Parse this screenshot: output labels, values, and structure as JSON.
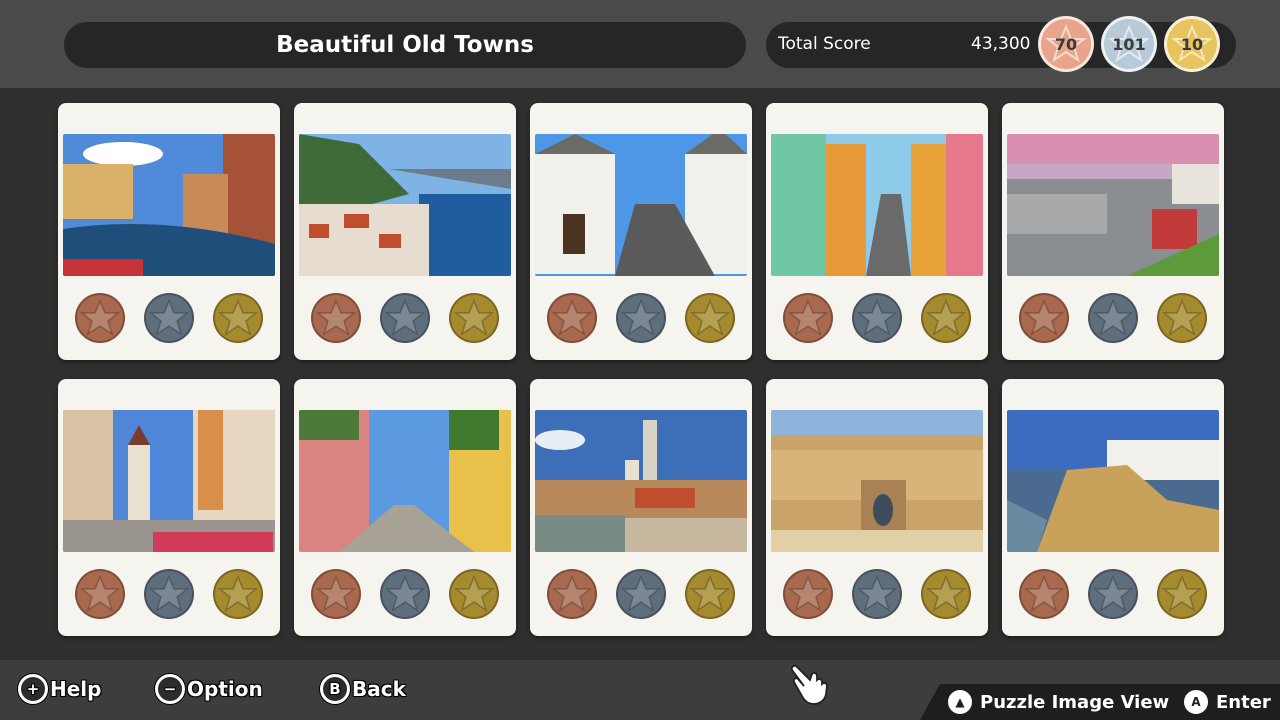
{
  "header": {
    "title": "Beautiful Old Towns",
    "score_label": "Total Score",
    "score_value": "43,300",
    "medals": {
      "bronze": "70",
      "silver": "101",
      "gold": "10"
    }
  },
  "colors": {
    "bronze": "#a8694f",
    "silver": "#5f6e7c",
    "gold": "#a58a2e",
    "card_bg": "#f6f4ee",
    "header_bg": "#4a4a4a"
  },
  "puzzles": [
    {
      "scene": "canal-town"
    },
    {
      "scene": "coastal-village"
    },
    {
      "scene": "trulli-street"
    },
    {
      "scene": "colorful-street"
    },
    {
      "scene": "hillside-city"
    },
    {
      "scene": "tower-street"
    },
    {
      "scene": "cobbled-lane"
    },
    {
      "scene": "castle-river"
    },
    {
      "scene": "desert-medina"
    },
    {
      "scene": "cliff-town"
    }
  ],
  "footer": {
    "help": "Help",
    "option": "Option",
    "back": "Back",
    "view": "Puzzle Image View",
    "enter": "Enter",
    "icons": {
      "help": "+",
      "option": "−",
      "back": "B",
      "view": "▲",
      "enter": "A"
    }
  }
}
